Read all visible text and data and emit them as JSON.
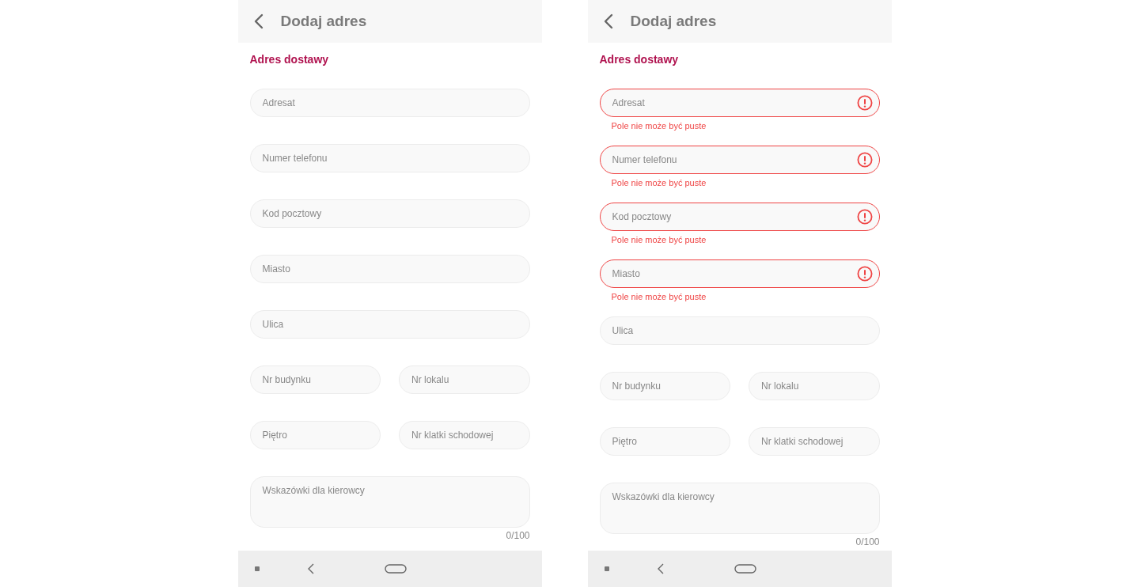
{
  "screens": [
    {
      "title": "Dodaj adres",
      "section_title": "Adres dostawy",
      "rows": [
        {
          "fields": [
            {
              "placeholder": "Adresat",
              "invalid": false
            }
          ]
        },
        {
          "fields": [
            {
              "placeholder": "Numer telefonu",
              "invalid": false
            }
          ]
        },
        {
          "fields": [
            {
              "placeholder": "Kod pocztowy",
              "invalid": false
            }
          ]
        },
        {
          "fields": [
            {
              "placeholder": "Miasto",
              "invalid": false
            }
          ]
        },
        {
          "fields": [
            {
              "placeholder": "Ulica",
              "invalid": false
            }
          ]
        },
        {
          "fields": [
            {
              "placeholder": "Nr budynku",
              "invalid": false
            },
            {
              "placeholder": "Nr lokalu",
              "invalid": false
            }
          ]
        },
        {
          "fields": [
            {
              "placeholder": "Piętro",
              "invalid": false
            },
            {
              "placeholder": "Nr klatki schodowej",
              "invalid": false
            }
          ]
        }
      ],
      "notes": {
        "placeholder": "Wskazówki dla kierowcy",
        "counter": "0/100"
      }
    },
    {
      "title": "Dodaj adres",
      "section_title": "Adres dostawy",
      "rows": [
        {
          "fields": [
            {
              "placeholder": "Adresat",
              "invalid": true,
              "error": "Pole nie może być puste"
            }
          ]
        },
        {
          "fields": [
            {
              "placeholder": "Numer telefonu",
              "invalid": true,
              "error": "Pole nie może być puste"
            }
          ]
        },
        {
          "fields": [
            {
              "placeholder": "Kod pocztowy",
              "invalid": true,
              "error": "Pole nie może być puste"
            }
          ]
        },
        {
          "fields": [
            {
              "placeholder": "Miasto",
              "invalid": true,
              "error": "Pole nie może być puste"
            }
          ]
        },
        {
          "fields": [
            {
              "placeholder": "Ulica",
              "invalid": false
            }
          ]
        },
        {
          "fields": [
            {
              "placeholder": "Nr budynku",
              "invalid": false
            },
            {
              "placeholder": "Nr lokalu",
              "invalid": false
            }
          ]
        },
        {
          "fields": [
            {
              "placeholder": "Piętro",
              "invalid": false
            },
            {
              "placeholder": "Nr klatki schodowej",
              "invalid": false
            }
          ]
        }
      ],
      "notes": {
        "placeholder": "Wskazówki dla kierowcy",
        "counter": "0/100"
      }
    }
  ]
}
